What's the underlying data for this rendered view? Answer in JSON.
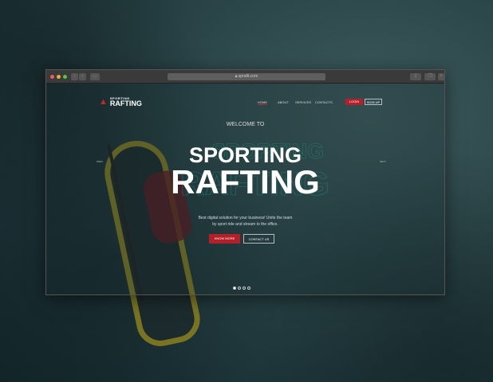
{
  "browser": {
    "url": "sprafit.com"
  },
  "logo": {
    "small": "SPORTING",
    "big": "RAFTING"
  },
  "nav": [
    "HOME",
    "ABOUT",
    "SERVICES",
    "CONTACTS"
  ],
  "auth": {
    "login": "LOGIN",
    "signup": "SIGN UP"
  },
  "hero": {
    "welcome": "WELCOME TO",
    "title1": "SPORTING",
    "title2": "RAFTING",
    "desc1": "Best digital solution for your business! Unite the team",
    "desc2": "by sport ride and stream to the office.",
    "know_more": "KNOW MORE",
    "contact": "CONTACT US",
    "prev": "PREV",
    "next": "NEXT"
  },
  "colors": {
    "accent": "#b3202a"
  }
}
